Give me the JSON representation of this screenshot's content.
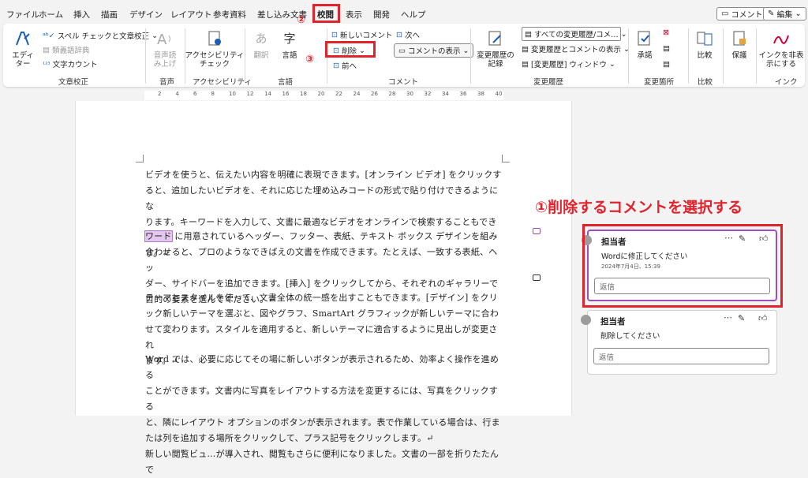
{
  "menu": {
    "tabs": [
      "ファイル",
      "ホーム",
      "挿入",
      "描画",
      "デザイン",
      "レイアウト",
      "参考資料",
      "差し込み文書",
      "校閲",
      "表示",
      "開発",
      "ヘルプ"
    ],
    "active": "校閲"
  },
  "topright": {
    "comments": "コメント",
    "edit": "編集"
  },
  "ribbon": {
    "editor": "エディ\nター",
    "spell": "スペル チェックと文章校正",
    "thesaurus": "類義語辞典",
    "wordcount": "文字カウント",
    "g_proof": "文章校正",
    "readaloud": "音声読\nみ上げ",
    "g_voice": "音声",
    "access": "アクセシビリティ\nチェック",
    "g_access": "アクセシビリティ",
    "translate": "翻訳",
    "language": "言語",
    "g_lang": "言語",
    "new_comment": "新しいコメント",
    "delete": "削除",
    "prev": "前へ",
    "next": "次へ",
    "show_comments": "コメントの表示",
    "g_comment": "コメント",
    "track": "変更履歴の\n記録",
    "markup_select": "すべての変更履歴/コメ…",
    "show_markup": "変更履歴とコメントの表示",
    "review_pane": "[変更履歴] ウィンドウ",
    "g_track": "変更履歴",
    "accept": "承諾",
    "g_changes": "変更箇所",
    "compare": "比較",
    "g_compare": "比較",
    "protect": "保護",
    "hide_ink": "インクを非表\n示にする",
    "g_ink": "インク"
  },
  "ruler": [
    "2",
    "4",
    "6",
    "8",
    "10",
    "12",
    "14",
    "16",
    "18",
    "20",
    "22",
    "24",
    "26",
    "28",
    "30",
    "32",
    "34",
    "36",
    "38",
    "40"
  ],
  "document": {
    "p1": [
      "ビデオを使うと、伝えたい内容を明確に表現できます。[オンライン ビデオ] をクリックす",
      "ると、追加したいビデオを、それに応じた埋め込みコードの形式で貼り付けできるようにな",
      "ります。キーワードを入力して、文書に最適なビデオをオンラインで検索することもできま",
      "す。↵"
    ],
    "highlight": "ワード",
    "p2first": "に用意されているヘッダー、フッター、表紙、テキスト ボックス デザインを組み",
    "p2": [
      "合わせると、プロのようなできばえの文書を作成できます。たとえば、一致する表紙、ヘッ",
      "ダー、サイドバーを追加できます。[挿入] をクリックしてから、それぞれのギャラリーで",
      "目的の要素を選んでください。↵"
    ],
    "p3": [
      "テーマとスタイルを使って、文書全体の統一感を出すこともできます。[デザイン] をクリ",
      "ック新しいテーマを選ぶと、図やグラフ、SmartArt グラフィックが新しいテーマに合わ",
      "せて変わります。スタイルを適用すると、新しいテーマに適合するように見出しが変更され",
      "ます。↵"
    ],
    "p4": [
      "Word では、必要に応じてその場に新しいボタンが表示されるため、効率よく操作を進める",
      "ことができます。文書内に写真をレイアウトする方法を変更するには、写真をクリックする",
      "と、隣にレイアウト オプションのボタンが表示されます。表で作業している場合は、行ま",
      "たは列を追加する場所をクリックして、プラス記号をクリックします。↵",
      "新しい閲覧ビュ…が導入され、閲覧もさらに便利になりました。文書の一部を折りたたんで"
    ]
  },
  "annotations": {
    "step1": "①削除するコメントを選択する",
    "step2": "②",
    "step3": "③"
  },
  "comments": [
    {
      "author": "担当者",
      "text": "Wordに修正してください",
      "date": "2024年7月4日、15:39",
      "reply": "返信"
    },
    {
      "author": "担当者",
      "text": "削除してください",
      "date": "",
      "reply": "返信"
    }
  ],
  "colors": {
    "accent_red": "#e0242e",
    "comment_purple": "#a04dbb",
    "highlight": "#e3c7ef"
  }
}
